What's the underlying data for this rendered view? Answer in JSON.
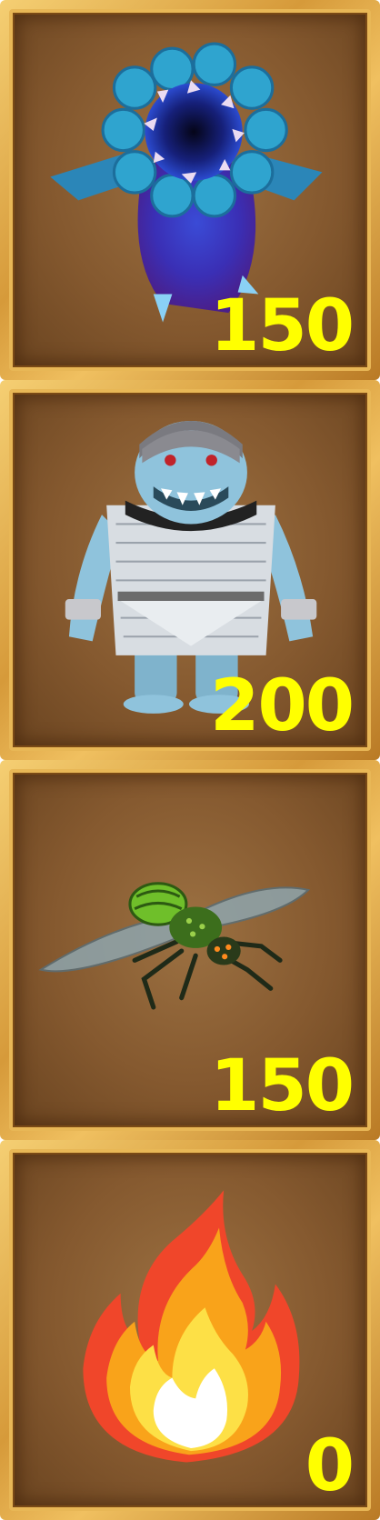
{
  "cards": [
    {
      "icon": "hive-pod-creature-icon",
      "cost": "150"
    },
    {
      "icon": "armored-troll-creature-icon",
      "cost": "200"
    },
    {
      "icon": "giant-fly-creature-icon",
      "cost": "150"
    },
    {
      "icon": "fire-icon",
      "cost": "0"
    }
  ],
  "colors": {
    "cost_text": "#ffff00",
    "frame_gold": "#d69a3a",
    "card_bg": "#85592f"
  }
}
